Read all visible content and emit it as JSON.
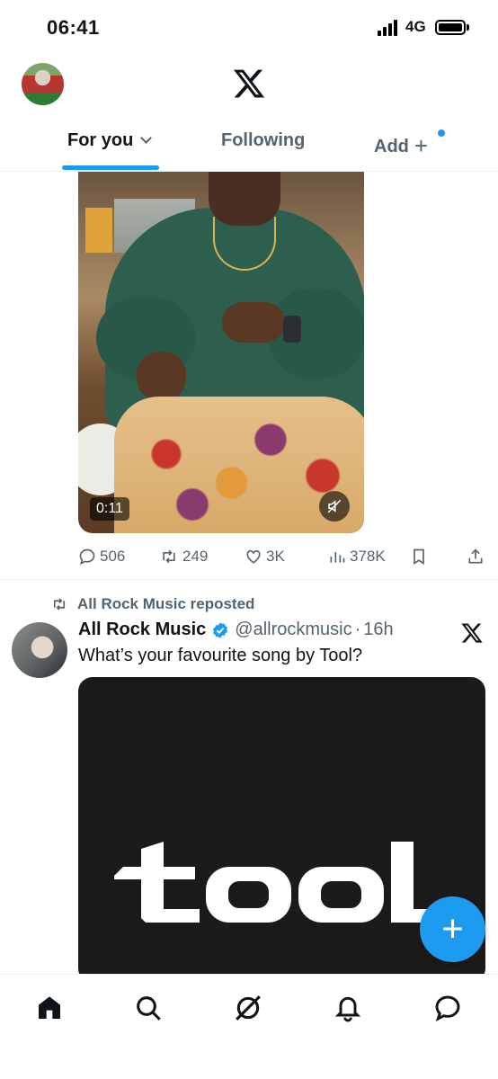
{
  "status_bar": {
    "time": "06:41",
    "network": "4G",
    "icons": [
      "signal-icon",
      "battery-icon"
    ]
  },
  "header": {
    "logo": "x-logo",
    "tabs": [
      {
        "label": "For you",
        "active": true
      },
      {
        "label": "Following",
        "active": false
      },
      {
        "label": "Add",
        "active": false
      }
    ]
  },
  "feed": {
    "post1": {
      "media": {
        "type": "video",
        "duration": "0:11",
        "muted": true
      },
      "stats": {
        "replies": "506",
        "reposts": "249",
        "likes": "3K",
        "views": "378K"
      }
    },
    "post2": {
      "repost_label": "All Rock Music reposted",
      "author_name": "All Rock Music",
      "verified": true,
      "handle": "@allrockmusic",
      "separator": "·",
      "time": "16h",
      "text": "What’s your favourite song by Tool?",
      "media": {
        "type": "image",
        "logo_text": "tool"
      }
    }
  },
  "fab": {
    "icon": "plus-icon",
    "symbol": "+"
  },
  "bottom_nav": [
    "home-icon",
    "search-icon",
    "grok-icon",
    "notifications-icon",
    "messages-icon"
  ],
  "colors": {
    "accent": "#1d9bf0",
    "text": "#0f1419",
    "secondary": "#536471"
  }
}
